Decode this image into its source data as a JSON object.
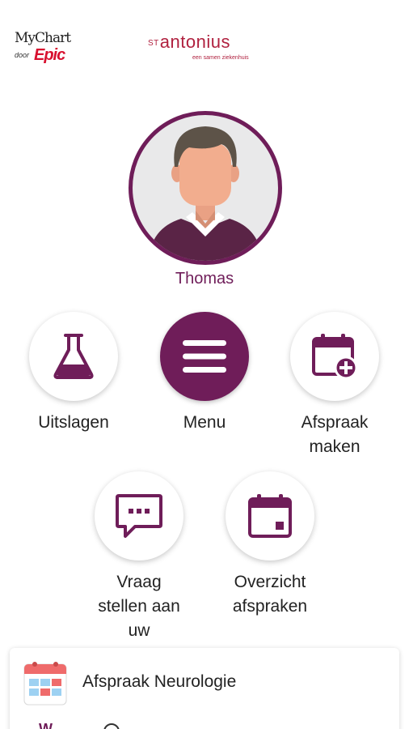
{
  "header": {
    "mychart_logo": {
      "top": "MyChart",
      "door": "door",
      "brand": "Epic"
    },
    "hospital_logo": {
      "prefix": "ST",
      "name": "antonius",
      "tagline": "een samen ziekenhuis"
    }
  },
  "profile": {
    "name": "Thomas",
    "avatar_icon": "person-avatar-icon"
  },
  "actions": [
    {
      "label": "Uitslagen",
      "icon": "flask-icon"
    },
    {
      "label": "Menu",
      "icon": "menu-icon"
    },
    {
      "label": "Afspraak\nmaken",
      "icon": "calendar-add-icon"
    },
    {
      "label": "Vraag\nstellen aan\nuw",
      "icon": "message-icon"
    },
    {
      "label": "Overzicht\nafspraken",
      "icon": "calendar-icon"
    }
  ],
  "upcoming_card": {
    "title": "Afspraak Neurologie",
    "day_partial": "W",
    "icon": "calendar-colored-icon"
  },
  "colors": {
    "brand_purple": "#6f1d59",
    "logo_red": "#b0213f",
    "epic_red": "#d8102f"
  }
}
